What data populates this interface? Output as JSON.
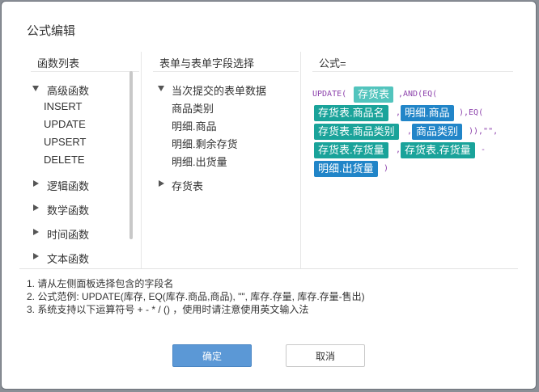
{
  "dialog": {
    "title": "公式编辑"
  },
  "functions": {
    "header": "函数列表",
    "groups": [
      {
        "label": "高级函数",
        "expanded": true,
        "items": [
          "INSERT",
          "UPDATE",
          "UPSERT",
          "DELETE"
        ]
      },
      {
        "label": "逻辑函数",
        "expanded": false
      },
      {
        "label": "数学函数",
        "expanded": false
      },
      {
        "label": "时间函数",
        "expanded": false
      },
      {
        "label": "文本函数",
        "expanded": false
      }
    ]
  },
  "fields": {
    "header": "表单与表单字段选择",
    "groups": [
      {
        "label": "当次提交的表单数据",
        "expanded": true,
        "items": [
          "商品类别",
          "明细.商品",
          "明细.剩余存货",
          "明细.出货量"
        ]
      },
      {
        "label": "存货表",
        "expanded": false
      }
    ]
  },
  "formula": {
    "header": "公式=",
    "tokens": {
      "update_open": "UPDATE(",
      "stock_table": "存货表",
      "and_eq": ",AND(EQ(",
      "stock_product_name": "存货表.商品名",
      "comma": ",",
      "detail_product": "明细.商品",
      "close_eq": "),EQ(",
      "stock_product_category": "存货表.商品类别",
      "product_category": "商品类别",
      "close_empty": ")),\"\",",
      "stock_qty": "存货表.存货量",
      "minus": "-",
      "detail_outbound": "明细.出货量",
      "close": ")"
    }
  },
  "help": {
    "lines": [
      "1. 请从左侧面板选择包含的字段名",
      "2. 公式范例: UPDATE(库存, EQ(库存.商品,商品), \"\", 库存.存量, 库存.存量-售出)",
      "3. 系统支持以下运算符号 + - * / () ，使用时请注意使用英文输入法"
    ]
  },
  "buttons": {
    "ok": "确定",
    "cancel": "取消"
  },
  "colors": {
    "field_pill": "#1aa39a",
    "form_pill": "#2185c8",
    "table_pill": "#52c4bd",
    "keyword": "#8e44ad",
    "primary_button": "#5b98d6"
  }
}
